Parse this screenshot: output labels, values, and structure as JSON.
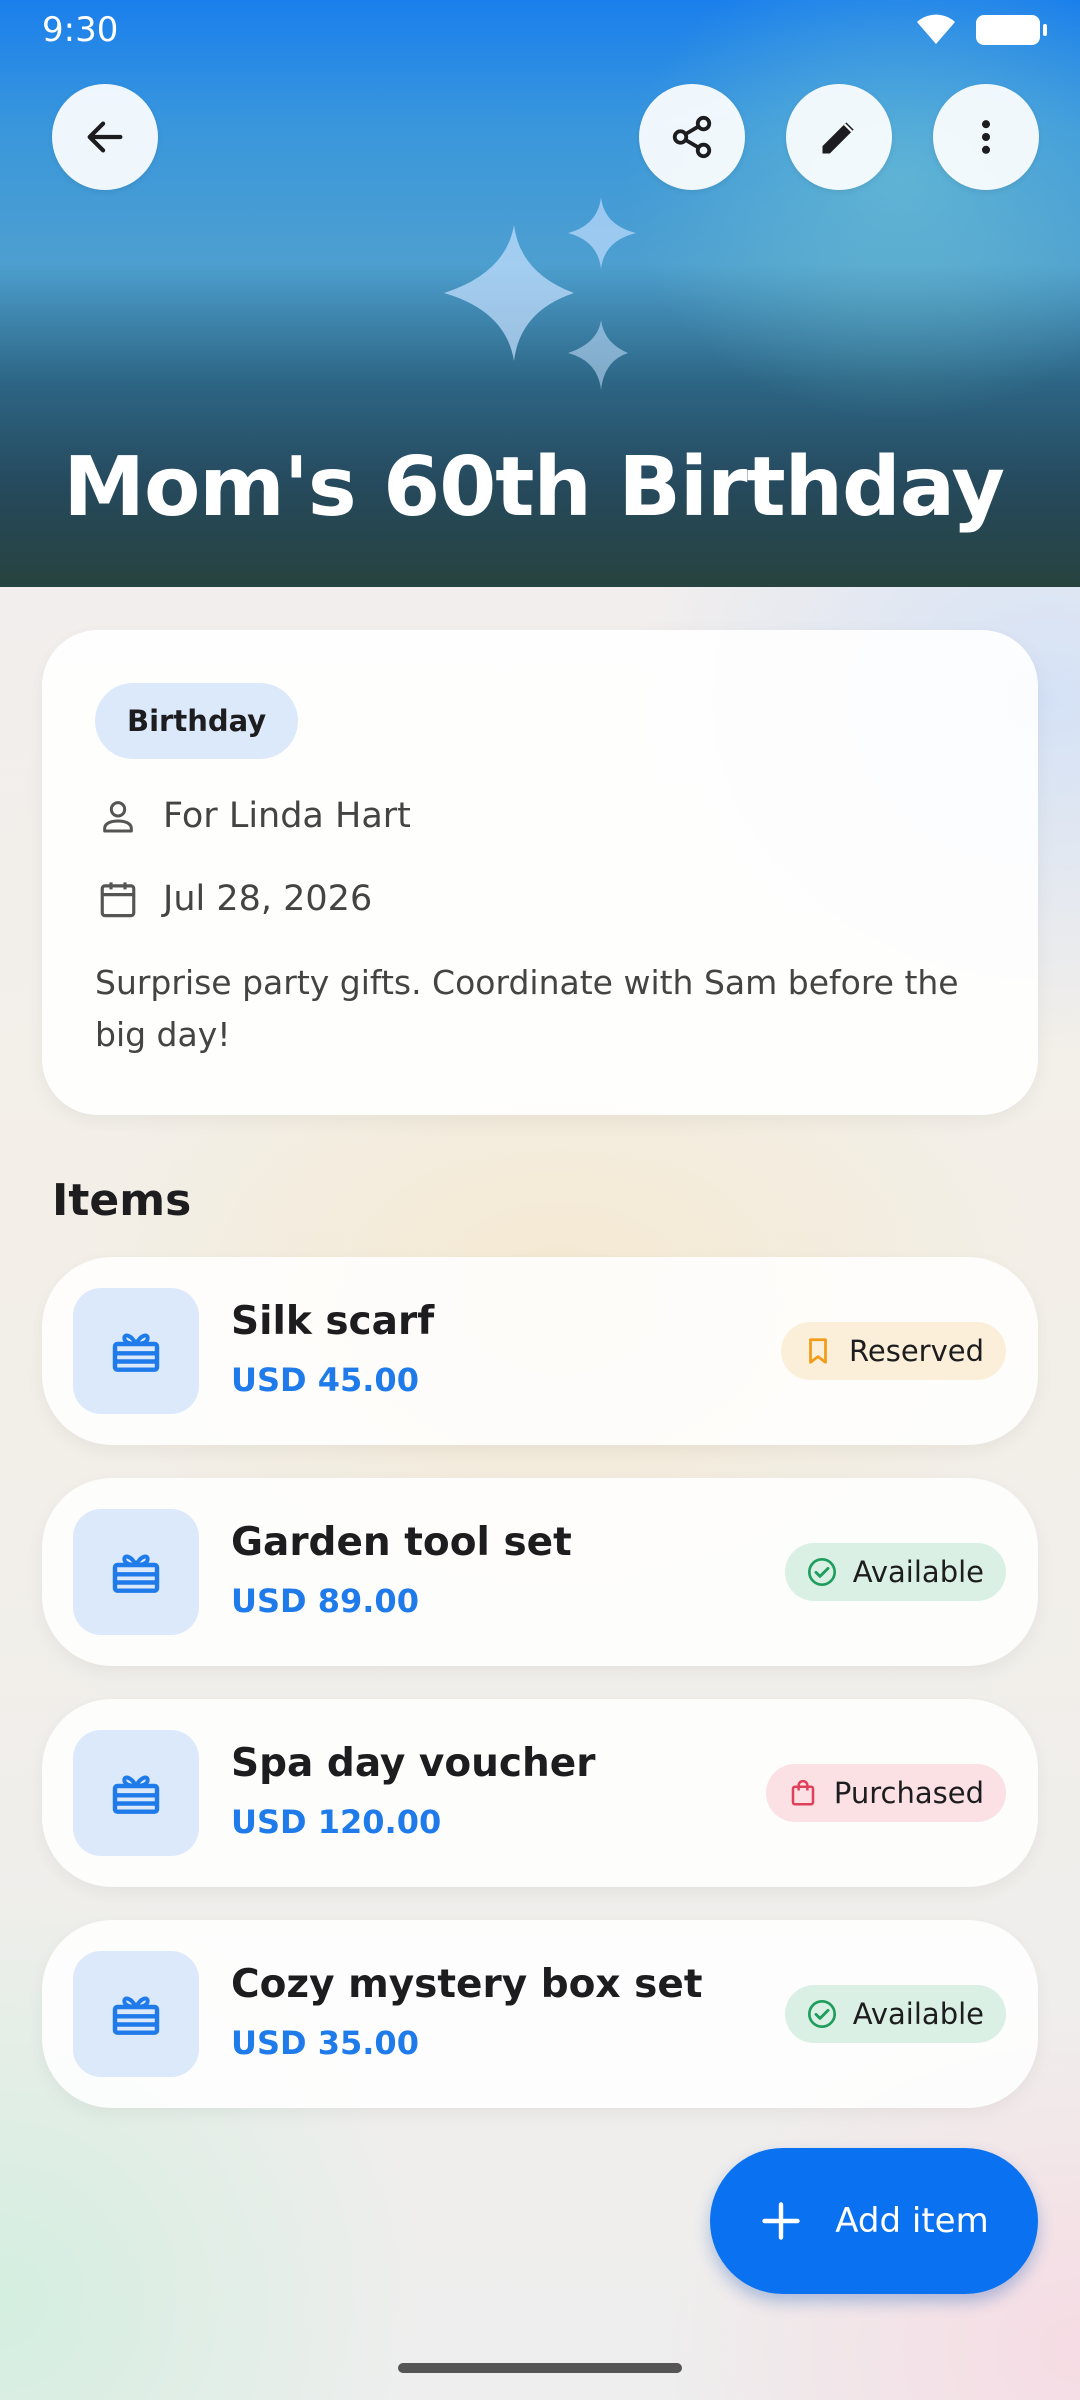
{
  "status_bar": {
    "time": "9:30"
  },
  "header": {
    "title": "Mom's 60th Birthday",
    "back_icon": "arrow-left-icon",
    "actions": [
      "share-icon",
      "edit-pencil-icon",
      "more-vert-icon"
    ]
  },
  "info": {
    "category": "Birthday",
    "recipient": "For Linda Hart",
    "date": "Jul 28, 2026",
    "note": "Surprise party gifts. Coordinate with Sam before the big day!"
  },
  "items_section": {
    "title": "Items"
  },
  "items": [
    {
      "name": "Silk scarf",
      "price": "USD 45.00",
      "status": "Reserved",
      "status_icon": "bookmark-icon",
      "status_color": "#f39c1a"
    },
    {
      "name": "Garden tool set",
      "price": "USD 89.00",
      "status": "Available",
      "status_icon": "check-circle-icon",
      "status_color": "#1e9d5c"
    },
    {
      "name": "Spa day voucher",
      "price": "USD 120.00",
      "status": "Purchased",
      "status_icon": "shopping-bag-icon",
      "status_color": "#e0405a"
    },
    {
      "name": "Cozy mystery box set",
      "price": "USD 35.00",
      "status": "Available",
      "status_icon": "check-circle-icon",
      "status_color": "#1e9d5c"
    }
  ],
  "fab": {
    "label": "Add item"
  },
  "colors": {
    "accent": "#1f7bea",
    "fab": "#0a72f0"
  }
}
